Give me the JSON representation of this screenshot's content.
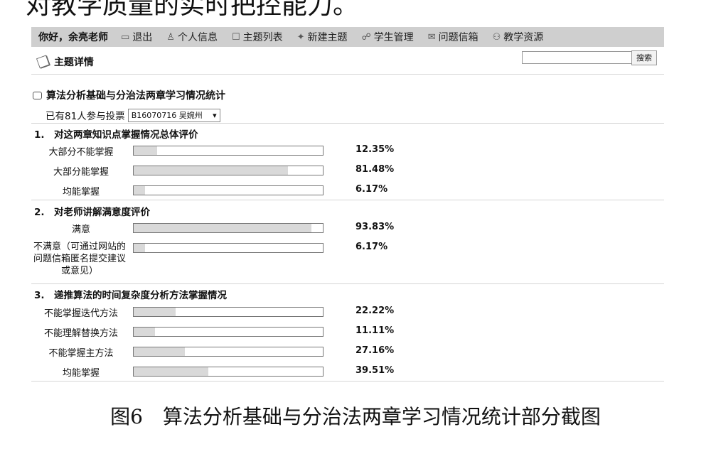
{
  "top_text": "对教学质量的实时把控能力。",
  "nav": {
    "greeting": "你好，余亮老师",
    "items": [
      {
        "label": "退出",
        "icon": "exit-icon",
        "glyph": "▭"
      },
      {
        "label": "个人信息",
        "icon": "user-icon",
        "glyph": "♙"
      },
      {
        "label": "主题列表",
        "icon": "list-icon",
        "glyph": "☐"
      },
      {
        "label": "新建主题",
        "icon": "new-topic-icon",
        "glyph": "✦"
      },
      {
        "label": "学生管理",
        "icon": "students-icon",
        "glyph": "☍"
      },
      {
        "label": "问题信箱",
        "icon": "mailbox-icon",
        "glyph": "✉"
      },
      {
        "label": "教学资源",
        "icon": "resources-icon",
        "glyph": "⚇"
      }
    ]
  },
  "page_title": "主题详情",
  "search": {
    "placeholder": "",
    "button_label": "搜索"
  },
  "poll": {
    "title": "算法分析基础与分治法两章学习情况统计",
    "voters_text": "已有81人参与投票",
    "voter_selected": "B16070716 吴婉州",
    "questions": [
      {
        "number": "1.",
        "title": "对这两章知识点掌握情况总体评价",
        "options": [
          {
            "label": "大部分不能掌握",
            "percent_text": "12.35%",
            "value": 12.35
          },
          {
            "label": "大部分能掌握",
            "percent_text": "81.48%",
            "value": 81.48
          },
          {
            "label": "均能掌握",
            "percent_text": "6.17%",
            "value": 6.17
          }
        ]
      },
      {
        "number": "2.",
        "title": "对老师讲解满意度评价",
        "options": [
          {
            "label": "满意",
            "percent_text": "93.83%",
            "value": 93.83
          },
          {
            "label": "不满意（可通过网站的问题信箱匿名提交建议或意见）",
            "percent_text": "6.17%",
            "value": 6.17
          }
        ]
      },
      {
        "number": "3.",
        "title": "递推算法的时间复杂度分析方法掌握情况",
        "options": [
          {
            "label": "不能掌握迭代方法",
            "percent_text": "22.22%",
            "value": 22.22
          },
          {
            "label": "不能理解替换方法",
            "percent_text": "11.11%",
            "value": 11.11
          },
          {
            "label": "不能掌握主方法",
            "percent_text": "27.16%",
            "value": 27.16
          },
          {
            "label": "均能掌握",
            "percent_text": "39.51%",
            "value": 39.51
          }
        ]
      }
    ]
  },
  "caption": "图6　算法分析基础与分治法两章学习情况统计部分截图"
}
